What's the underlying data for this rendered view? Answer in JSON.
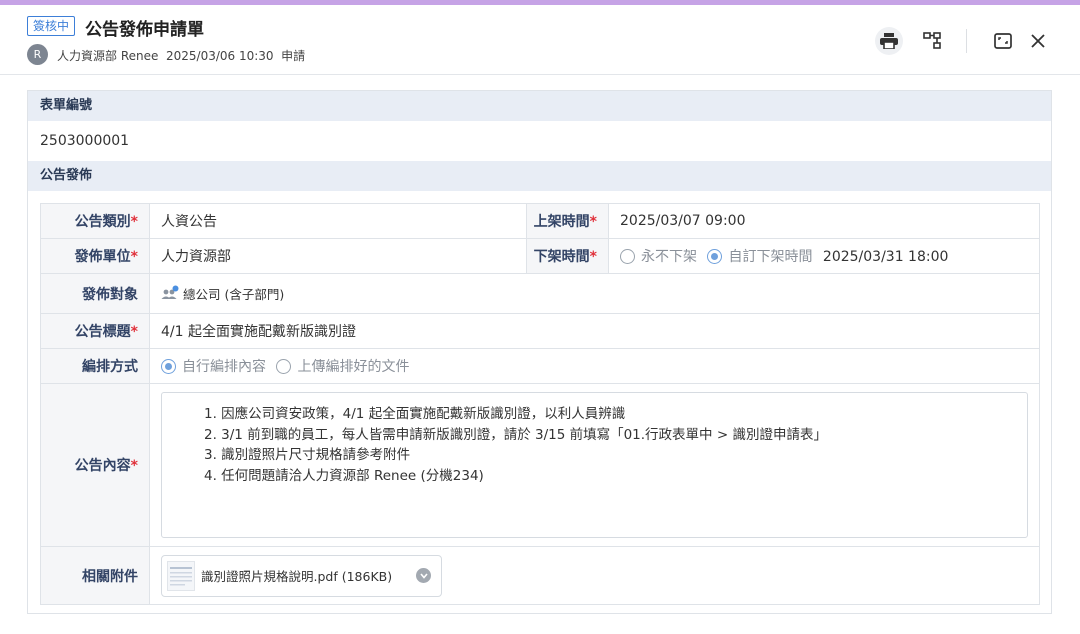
{
  "header": {
    "status_badge": "簽核中",
    "title": "公告發佈申請單",
    "avatar_initial": "R",
    "meta": "人力資源部 Renee  2025/03/06 10:30  申請"
  },
  "form": {
    "number_section_label": "表單編號",
    "number_value": "2503000001",
    "section_label": "公告發佈",
    "category_label": "公告類別",
    "category_value": "人資公告",
    "publish_time_label": "上架時間",
    "publish_time_value": "2025/03/07 09:00",
    "unit_label": "發佈單位",
    "unit_value": "人力資源部",
    "unpublish_label": "下架時間",
    "unpublish_option_never": "永不下架",
    "unpublish_option_custom": "自訂下架時間",
    "unpublish_value": "2025/03/31 18:00",
    "target_label": "發佈對象",
    "target_value": "總公司 (含子部門)",
    "subject_label": "公告標題",
    "subject_value": "4/1 起全面實施配戴新版識別證",
    "layout_label": "編排方式",
    "layout_option_self": "自行編排內容",
    "layout_option_upload": "上傳編排好的文件",
    "content_label": "公告內容",
    "content_lines": [
      "1. 因應公司資安政策，4/1 起全面實施配戴新版識別證，以利人員辨識",
      "2. 3/1 前到職的員工，每人皆需申請新版識別證，請於 3/15 前填寫「01.行政表單中 > 識別證申請表」",
      "3. 識別證照片尺寸規格請參考附件",
      "4. 任何問題請洽人力資源部 Renee (分機234)"
    ],
    "attachment_label": "相關附件",
    "attachment_name": "識別證照片規格說明.pdf (186KB)",
    "required_mark": "*"
  },
  "icons": {
    "print": "print-icon",
    "flow": "workflow-icon",
    "expand": "expand-icon",
    "close": "close-icon",
    "group": "group-icon",
    "file": "file-icon",
    "dropdown": "chevron-down-icon"
  }
}
